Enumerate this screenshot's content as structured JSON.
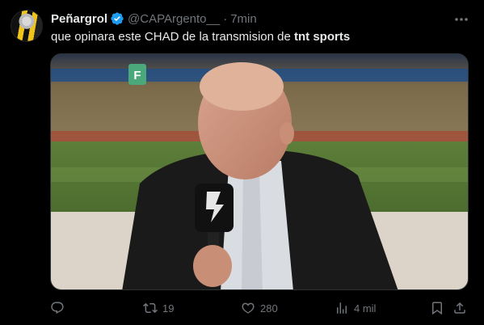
{
  "tweet": {
    "display_name": "Peñargrol",
    "handle": "@CAPArgento__",
    "separator": "·",
    "time": "7min",
    "text_before": "que opinara este CHAD de la transmision de ",
    "text_bold": "tnt sports",
    "media_channel_badge": "F"
  },
  "actions": {
    "reply": {
      "icon": "reply-icon",
      "count": ""
    },
    "retweet": {
      "icon": "retweet-icon",
      "count": "19"
    },
    "like": {
      "icon": "heart-icon",
      "count": "280"
    },
    "views": {
      "icon": "views-icon",
      "count": "4 mil"
    },
    "bookmark": {
      "icon": "bookmark-icon",
      "count": ""
    },
    "share": {
      "icon": "share-icon",
      "count": ""
    }
  },
  "colors": {
    "background": "#000000",
    "text": "#e7e9ea",
    "muted": "#71767b",
    "verified": "#1d9bf0"
  }
}
